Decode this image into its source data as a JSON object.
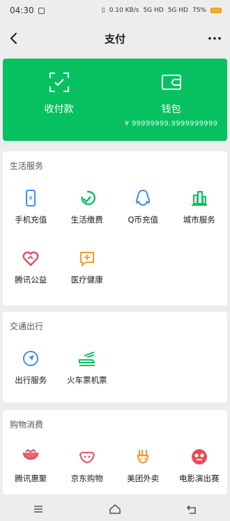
{
  "status": {
    "time": "04:30",
    "speed": "0.10",
    "speed_unit": "KB/s",
    "net1": "5G HD",
    "net2": "5G HD",
    "battery": "75%"
  },
  "nav": {
    "title": "支付"
  },
  "card": {
    "receive_label": "收付款",
    "wallet_label": "钱包",
    "wallet_balance": "¥ 99999999.9999999999"
  },
  "sections": [
    {
      "title": "生活服务",
      "items": [
        {
          "label": "手机充值",
          "icon": "phone-recharge-icon",
          "color": "#3d8ef0"
        },
        {
          "label": "生活缴费",
          "icon": "utility-payment-icon",
          "color": "#07c160"
        },
        {
          "label": "Q币充值",
          "icon": "qq-coin-icon",
          "color": "#3d8ef0"
        },
        {
          "label": "城市服务",
          "icon": "city-service-icon",
          "color": "#07c160"
        },
        {
          "label": "腾讯公益",
          "icon": "charity-heart-icon",
          "color": "#e84c5a"
        },
        {
          "label": "医疗健康",
          "icon": "medical-health-icon",
          "color": "#f39c2b"
        }
      ]
    },
    {
      "title": "交通出行",
      "items": [
        {
          "label": "出行服务",
          "icon": "travel-service-icon",
          "color": "#3d8ef0"
        },
        {
          "label": "火车票机票",
          "icon": "train-plane-ticket-icon",
          "color": "#07c160"
        }
      ]
    },
    {
      "title": "购物消费",
      "items": [
        {
          "label": "腾讯惠聚",
          "icon": "tencent-huiju-icon",
          "color": "#e84c5a"
        },
        {
          "label": "京东购物",
          "icon": "jd-shopping-icon",
          "color": "#e84c5a"
        },
        {
          "label": "美团外卖",
          "icon": "meituan-waimai-icon",
          "color": "#f39c2b"
        },
        {
          "label": "电影演出赛",
          "icon": "movie-show-icon",
          "color": "#e84c5a"
        }
      ]
    }
  ]
}
